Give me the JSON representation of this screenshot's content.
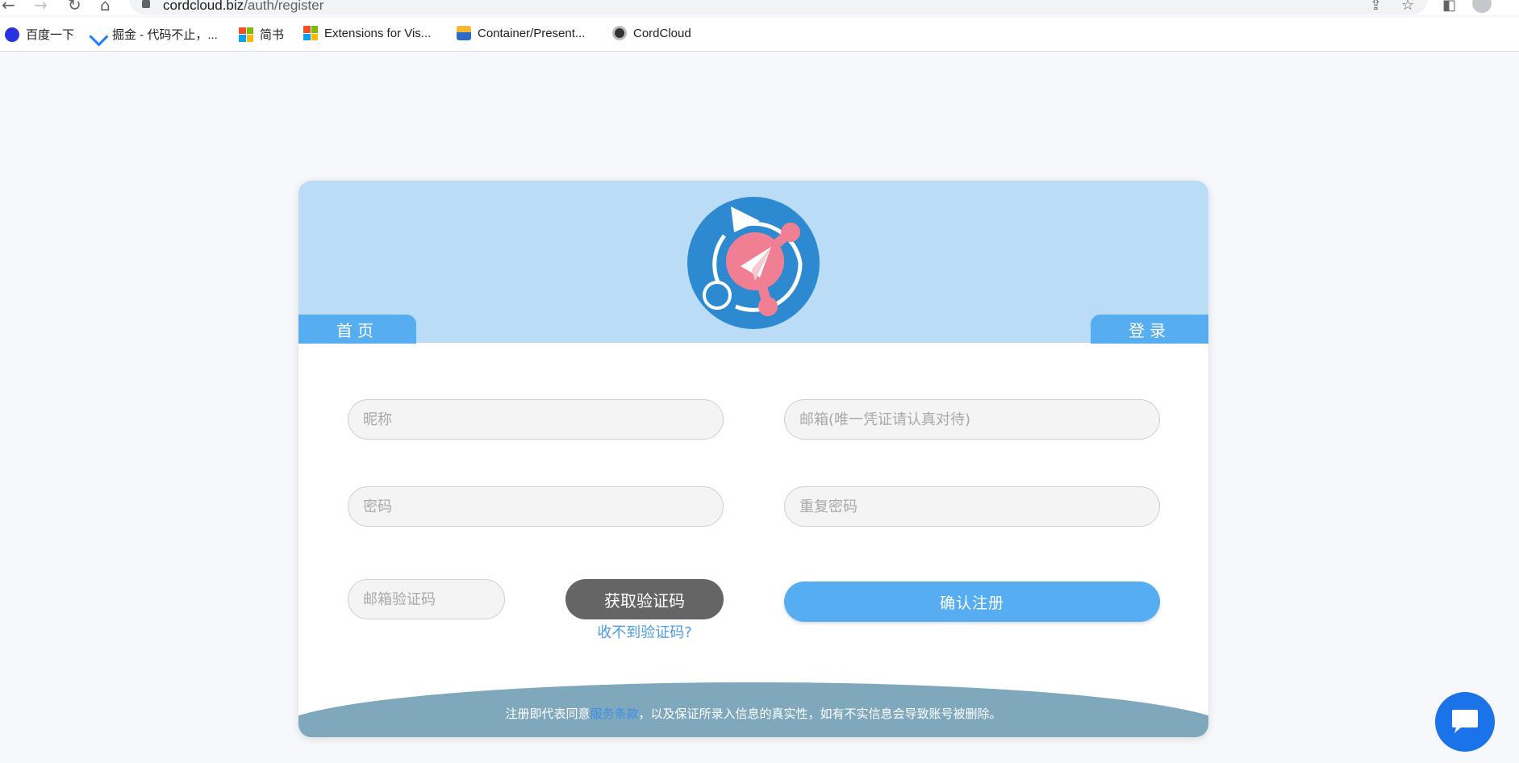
{
  "browser": {
    "url_host": "cordcloud.biz",
    "url_path": "/auth/register",
    "bookmarks": [
      {
        "label": "百度一下",
        "icon": "baidu-icon"
      },
      {
        "label": "掘金 - 代码不止，...",
        "icon": "juejin-icon"
      },
      {
        "label": "简书",
        "icon": "microsoft-icon"
      },
      {
        "label": "Extensions for Vis...",
        "icon": "microsoft-icon"
      },
      {
        "label": "Container/Present...",
        "icon": "container-icon"
      },
      {
        "label": "CordCloud",
        "icon": "cordcloud-icon"
      }
    ]
  },
  "header": {
    "home_tab": "首页",
    "login_tab": "登录"
  },
  "form": {
    "nickname_placeholder": "昵称",
    "email_placeholder": "邮箱(唯一凭证请认真对待)",
    "password_placeholder": "密码",
    "repeat_password_placeholder": "重复密码",
    "email_code_placeholder": "邮箱验证码",
    "get_code_button": "获取验证码",
    "no_code_link": "收不到验证码?",
    "register_button": "确认注册"
  },
  "footer": {
    "prefix": "注册即代表同意",
    "terms_link": "服务条款",
    "suffix": "，以及保证所录入信息的真实性，如有不实信息会导致账号被删除。"
  },
  "colors": {
    "header_bg": "#bbdcf7",
    "tab_bg": "#56adef",
    "register_button": "#56adf2",
    "code_button": "#656565",
    "footer_band": "#7fa8bd",
    "chat_button": "#1a73e8"
  }
}
